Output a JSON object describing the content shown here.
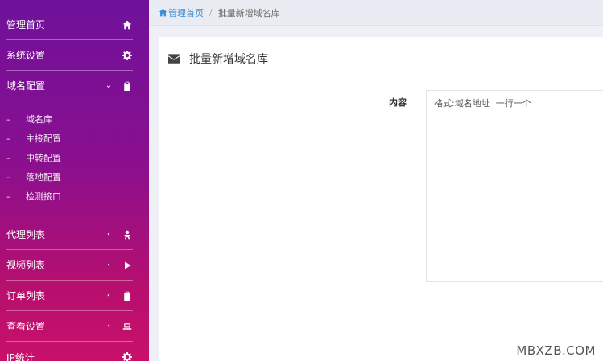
{
  "sidebar": {
    "menu": [
      {
        "label": "管理首页",
        "icon": "home-icon",
        "chevron": ""
      },
      {
        "label": "系统设置",
        "icon": "gear-icon",
        "chevron": ""
      },
      {
        "label": "域名配置",
        "icon": "clipboard-icon",
        "chevron": "⌄"
      }
    ],
    "submenu": [
      {
        "dash": "–",
        "label": "域名库"
      },
      {
        "dash": "–",
        "label": "主接配置"
      },
      {
        "dash": "–",
        "label": "中转配置"
      },
      {
        "dash": "–",
        "label": "落地配置"
      },
      {
        "dash": "–",
        "label": "检测接口"
      }
    ],
    "menu_lower": [
      {
        "label": "代理列表",
        "icon": "user-icon",
        "chevron": "‹"
      },
      {
        "label": "视频列表",
        "icon": "play-icon",
        "chevron": "‹"
      },
      {
        "label": "订单列表",
        "icon": "clipboard-icon",
        "chevron": "‹"
      },
      {
        "label": "查看设置",
        "icon": "laptop-icon",
        "chevron": "‹"
      },
      {
        "label": "IP统计",
        "icon": "gear-icon",
        "chevron": ""
      }
    ]
  },
  "breadcrumb": {
    "home": "管理首页",
    "separator": "/",
    "current": "批量新增域名库"
  },
  "card": {
    "icon": "envelope-icon",
    "title": "批量新增域名库",
    "field_label": "内容",
    "content_placeholder": "格式:域名地址  一行一个",
    "content_value": ""
  },
  "watermark": "MBXZB.COM"
}
